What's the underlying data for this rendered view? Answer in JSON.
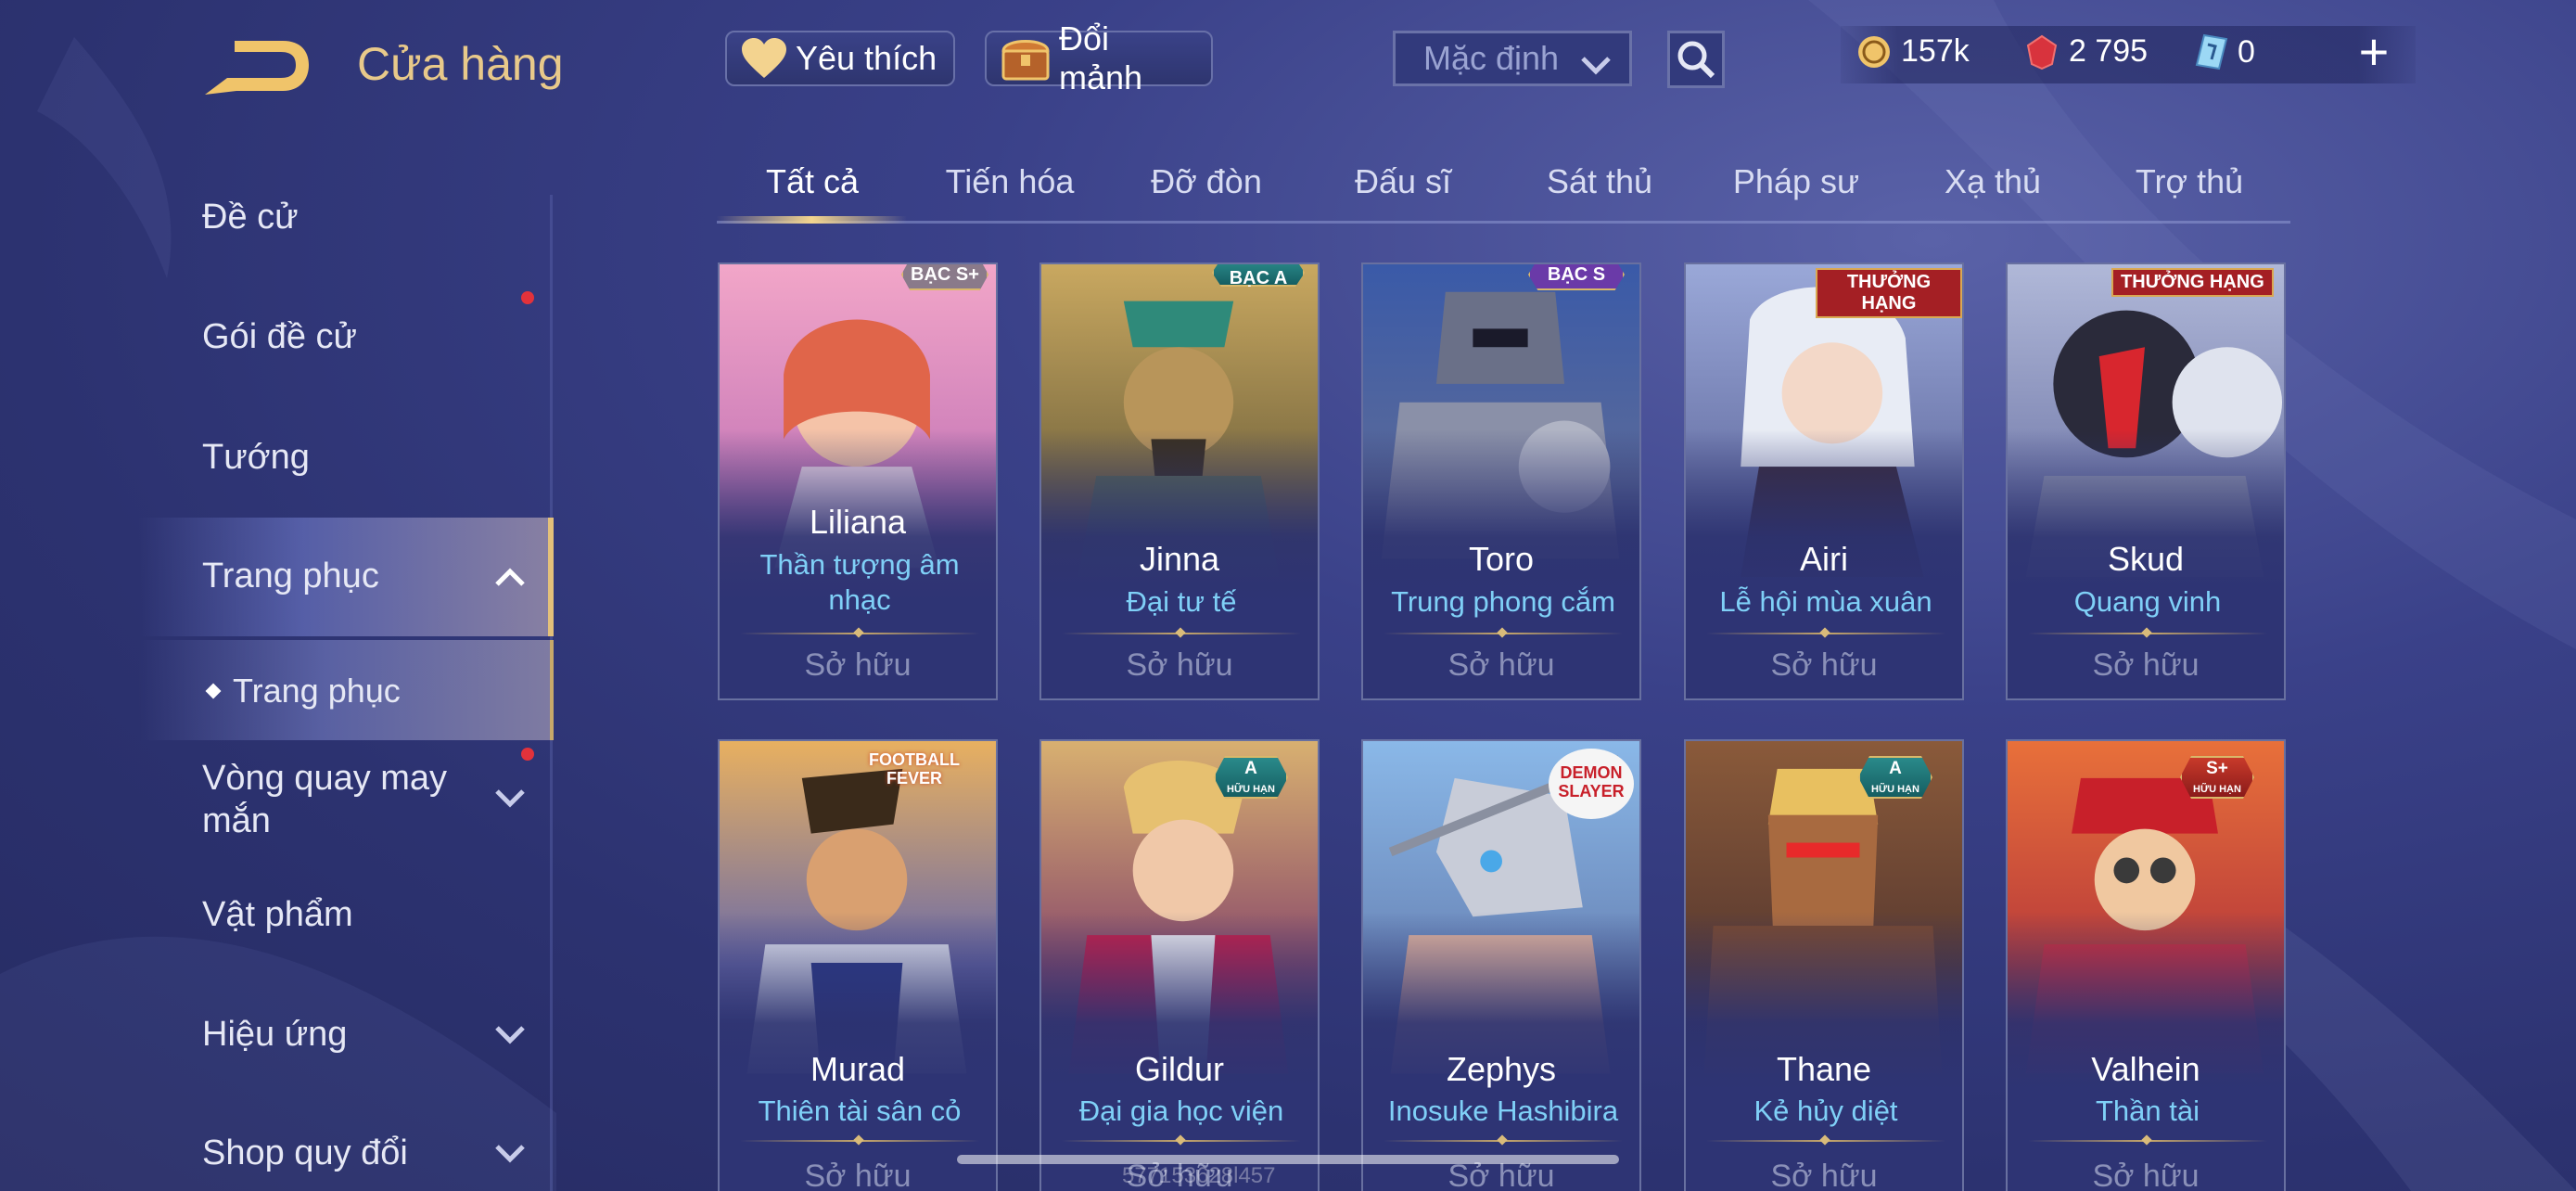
{
  "header": {
    "title": "Cửa hàng",
    "favorite_label": "Yêu thích",
    "exchange_label": "Đổi mảnh",
    "sort_select": "Mặc định"
  },
  "currencies": [
    {
      "name": "gold-coin-icon",
      "value": "157k"
    },
    {
      "name": "ruby-icon",
      "value": "2 795"
    },
    {
      "name": "voucher-icon",
      "value": "0"
    }
  ],
  "sidebar": {
    "items": [
      {
        "label": "Đề cử"
      },
      {
        "label": "Gói đề cử"
      },
      {
        "label": "Tướng"
      },
      {
        "label": "Trang phục"
      },
      {
        "label": "Trang phục"
      },
      {
        "label": "Vòng quay may mắn"
      },
      {
        "label": "Vật phẩm"
      },
      {
        "label": "Hiệu ứng"
      },
      {
        "label": "Shop quy đổi"
      }
    ]
  },
  "tabs": [
    "Tất cả",
    "Tiến hóa",
    "Đỡ đòn",
    "Đấu sĩ",
    "Sát thủ",
    "Pháp sư",
    "Xạ thủ",
    "Trợ thủ"
  ],
  "cards": [
    {
      "hero": "Liliana",
      "skin": "Thần tượng âm nhạc",
      "status": "Sở hữu",
      "badge": "BẠC S+"
    },
    {
      "hero": "Jinna",
      "skin": "Đại tư tế",
      "status": "Sở hữu",
      "badge": "BẠC A"
    },
    {
      "hero": "Toro",
      "skin": "Trung phong cắm",
      "status": "Sở hữu",
      "badge": "BẠC S"
    },
    {
      "hero": "Airi",
      "skin": "Lễ hội mùa xuân",
      "status": "Sở hữu",
      "badge": "THƯỞNG HẠNG"
    },
    {
      "hero": "Skud",
      "skin": "Quang vinh",
      "status": "Sở hữu",
      "badge": "THƯỞNG HẠNG"
    },
    {
      "hero": "Murad",
      "skin": "Thiên tài sân cỏ",
      "status": "Sở hữu",
      "badge": "FOOTBALL FEVER"
    },
    {
      "hero": "Gildur",
      "skin": "Đại gia học viện",
      "status": "Sở hữu",
      "badge": "A",
      "badge_sub": "HỮU HẠN"
    },
    {
      "hero": "Zephys",
      "skin": "Inosuke Hashibira",
      "status": "Sở hữu",
      "badge": "DEMON SLAYER"
    },
    {
      "hero": "Thane",
      "skin": "Kẻ hủy diệt",
      "status": "Sở hữu",
      "badge": "A",
      "badge_sub": "HỮU HẠN"
    },
    {
      "hero": "Valhein",
      "skin": "Thần tài",
      "status": "Sở hữu",
      "badge": "S+",
      "badge_sub": "HỮU HẠN"
    }
  ],
  "watermark": "577153628l457",
  "colors": {
    "accent_gold": "#e8c98a",
    "skin_name": "#7fd0f7",
    "badge_red": "#a41f24",
    "notification": "#e2323b"
  }
}
